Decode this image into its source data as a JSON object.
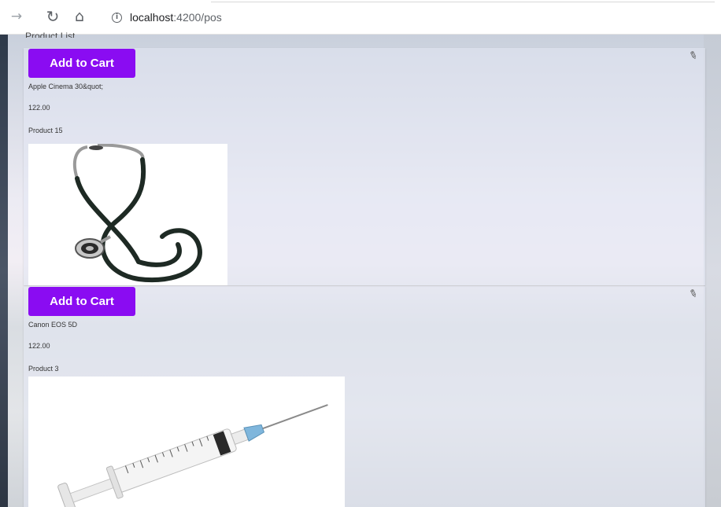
{
  "browser": {
    "url_host": "localhost",
    "url_path": ":4200/pos",
    "icons": {
      "back": "arrow-right-icon",
      "reload": "reload-icon",
      "home": "home-icon",
      "info": "info-icon"
    }
  },
  "page": {
    "heading": "Product List"
  },
  "products": [
    {
      "button_label": "Add to Cart",
      "name": "Apple Cinema 30&quot;",
      "price": "122.00",
      "code": "Product 15",
      "image_icon": "stethoscope-icon"
    },
    {
      "button_label": "Add to Cart",
      "name": "Canon EOS 5D",
      "price": "122.00",
      "code": "Product 3",
      "image_icon": "syringe-icon"
    }
  ],
  "colors": {
    "button": "#8a0cf2",
    "button_text": "#ffffff"
  }
}
